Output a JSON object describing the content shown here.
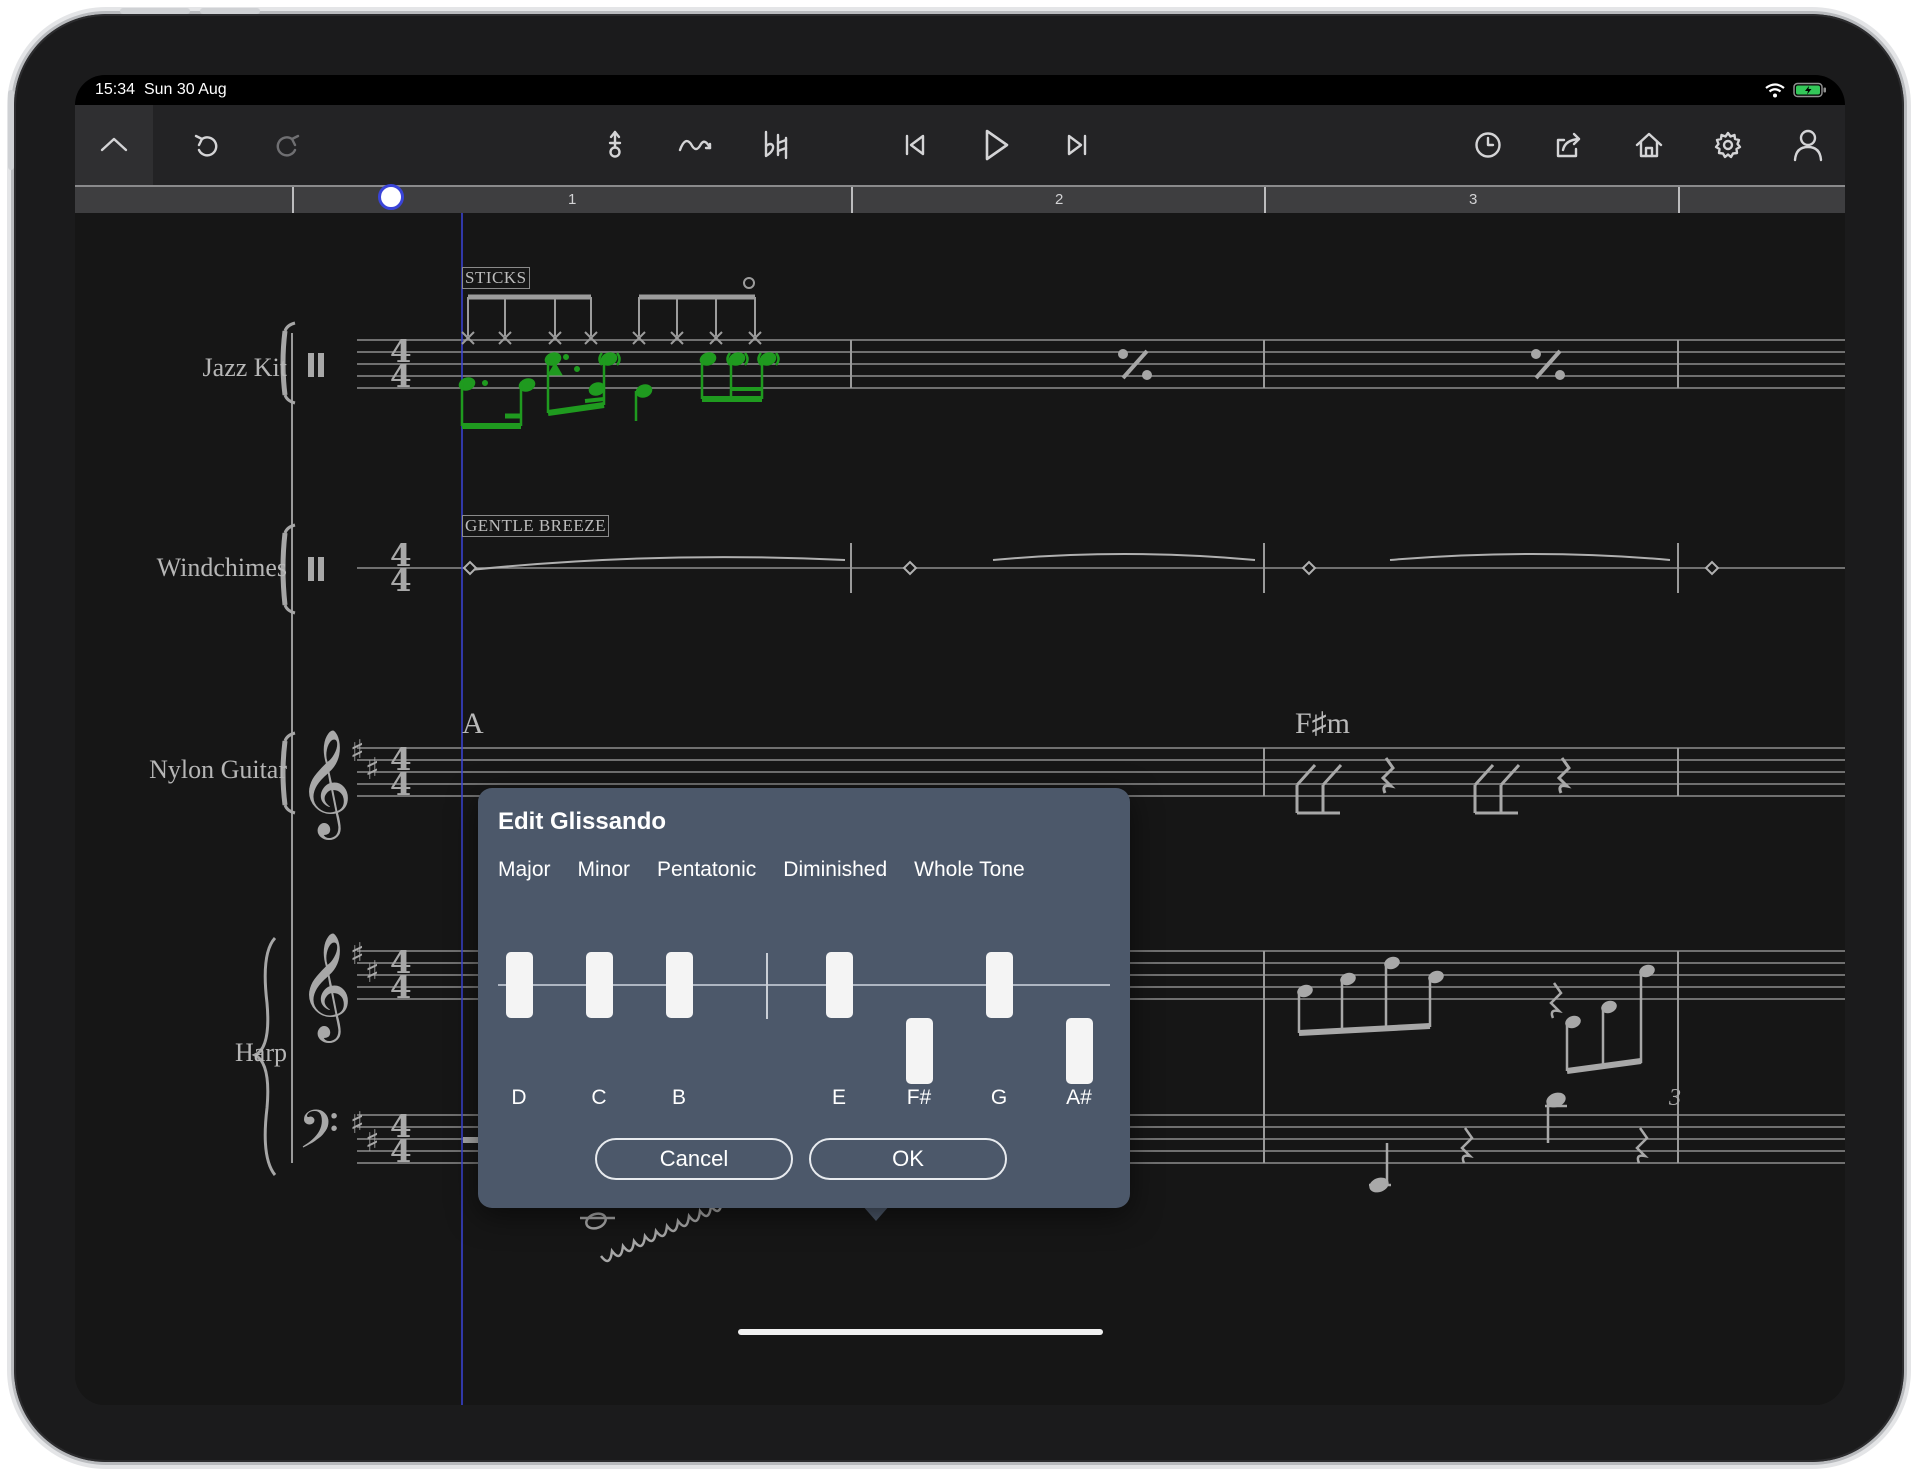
{
  "status_bar": {
    "time": "15:34",
    "date": "Sun 30 Aug"
  },
  "toolbar": {
    "collapse_icon": "chevron-up-icon",
    "undo_icon": "undo-icon",
    "redo_icon": "redo-icon",
    "metronome_icon": "metronome-icon",
    "glissando_icon": "glissando-icon",
    "accidental_icon": "flat-natural-icon",
    "skip_back_icon": "skip-back-icon",
    "play_icon": "play-icon",
    "skip_forward_icon": "skip-forward-icon",
    "history_icon": "clock-icon",
    "share_icon": "share-icon",
    "home_icon": "home-icon",
    "settings_icon": "gear-icon",
    "account_icon": "person-icon"
  },
  "ruler": {
    "bars": [
      "1",
      "2",
      "3"
    ]
  },
  "score": {
    "instruments": [
      "Jazz Kit",
      "Windchimes",
      "Nylon Guitar",
      "Harp"
    ],
    "tags": {
      "sticks": "STICKS",
      "gentle_breeze": "GENTLE BREEZE"
    },
    "chords": {
      "guitar_partial": "A",
      "guitar_bar3": "F♯m"
    },
    "tuplet": "3",
    "time_signature": "4/4",
    "colors": {
      "selected_notes": "#1f9a1f",
      "playhead": "#3a44d8",
      "background": "#161616"
    }
  },
  "dialog": {
    "title": "Edit Glissando",
    "scales": [
      "Major",
      "Minor",
      "Pentatonic",
      "Diminished",
      "Whole Tone"
    ],
    "keys": [
      "D",
      "C",
      "B",
      "E",
      "F#",
      "G",
      "A#"
    ],
    "cancel_label": "Cancel",
    "ok_label": "OK"
  }
}
